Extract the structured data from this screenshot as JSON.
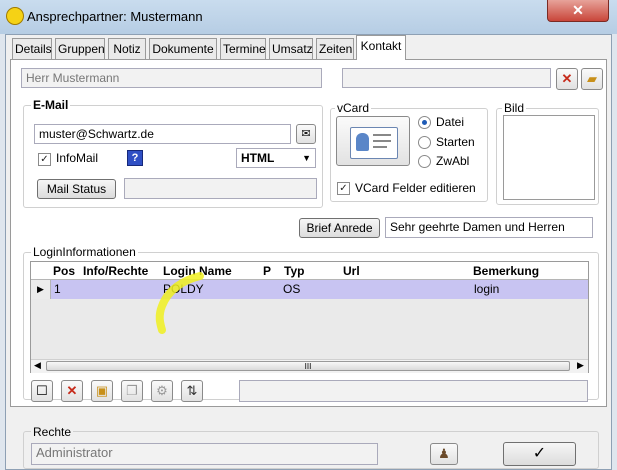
{
  "window": {
    "title": "Ansprechpartner: Mustermann",
    "close": "✕"
  },
  "tabs": [
    {
      "label": "Details"
    },
    {
      "label": "Gruppen"
    },
    {
      "label": "Notiz"
    },
    {
      "label": "Dokumente"
    },
    {
      "label": "Termine"
    },
    {
      "label": "Umsatz"
    },
    {
      "label": "Zeiten"
    },
    {
      "label": "Kontakt"
    }
  ],
  "contact": {
    "name_value": "Herr  Mustermann"
  },
  "email": {
    "legend": "E-Mail",
    "address": "muster@Schwartz.de",
    "infomail_label": "InfoMail",
    "infomail_checked": true,
    "format_value": "HTML",
    "mail_status_label": "Mail Status"
  },
  "vcard": {
    "legend": "vCard",
    "options": [
      "Datei",
      "Starten",
      "ZwAbl"
    ],
    "selected": "Datei",
    "edit_fields_label": "VCard Felder editieren"
  },
  "bild": {
    "legend": "Bild"
  },
  "brief": {
    "button_label": "Brief  Anrede",
    "anrede_value": "Sehr geehrte Damen und Herren"
  },
  "login": {
    "legend": "LoginInformationen",
    "columns": [
      "Pos",
      "Info/Rechte",
      "Login Name",
      "P",
      "Typ",
      "Url",
      "Bemerkung"
    ],
    "rows": [
      {
        "pos": "1",
        "info": "",
        "login": "POLDY",
        "p": "",
        "typ": "OS",
        "url": "",
        "bemerkung": "login"
      }
    ],
    "scroll_mid": "III"
  },
  "rechte": {
    "legend": "Rechte",
    "value": "Administrator"
  },
  "ok_button": {
    "label": "✓"
  }
}
